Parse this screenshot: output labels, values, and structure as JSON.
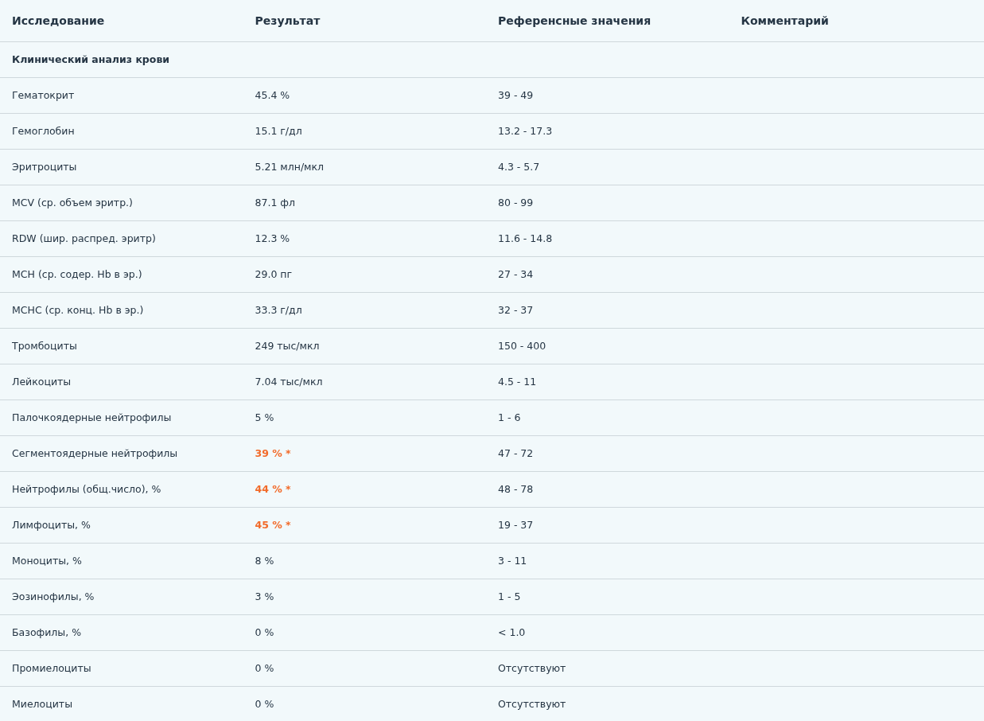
{
  "table": {
    "columns": [
      "Исследование",
      "Результат",
      "Референсные значения",
      "Комментарий"
    ],
    "section": "Клинический анализ крови",
    "rows": [
      {
        "name": "Гематокрит",
        "result": "45.4 %",
        "abnormal": false,
        "reference": "39 - 49"
      },
      {
        "name": "Гемоглобин",
        "result": "15.1 г/дл",
        "abnormal": false,
        "reference": "13.2 - 17.3"
      },
      {
        "name": "Эритроциты",
        "result": "5.21 млн/мкл",
        "abnormal": false,
        "reference": "4.3 - 5.7"
      },
      {
        "name": "MCV (ср. объем эритр.)",
        "result": "87.1 фл",
        "abnormal": false,
        "reference": "80 - 99"
      },
      {
        "name": "RDW (шир. распред. эритр)",
        "result": "12.3 %",
        "abnormal": false,
        "reference": "11.6 - 14.8"
      },
      {
        "name": "MCH (ср. содер. Hb в эр.)",
        "result": "29.0 пг",
        "abnormal": false,
        "reference": "27 - 34"
      },
      {
        "name": "MCHC (ср. конц. Hb в эр.)",
        "result": "33.3 г/дл",
        "abnormal": false,
        "reference": "32 - 37"
      },
      {
        "name": "Тромбоциты",
        "result": "249 тыс/мкл",
        "abnormal": false,
        "reference": "150 - 400"
      },
      {
        "name": "Лейкоциты",
        "result": "7.04 тыс/мкл",
        "abnormal": false,
        "reference": "4.5 - 11"
      },
      {
        "name": "Палочкоядерные нейтрофилы",
        "result": "5 %",
        "abnormal": false,
        "reference": "1 - 6"
      },
      {
        "name": "Сегментоядерные нейтрофилы",
        "result": "39 % *",
        "abnormal": true,
        "reference": "47 - 72"
      },
      {
        "name": "Нейтрофилы (общ.число), %",
        "result": "44 % *",
        "abnormal": true,
        "reference": "48 - 78"
      },
      {
        "name": "Лимфоциты, %",
        "result": "45 % *",
        "abnormal": true,
        "reference": "19 - 37"
      },
      {
        "name": "Моноциты, %",
        "result": "8 %",
        "abnormal": false,
        "reference": "3 - 11"
      },
      {
        "name": "Эозинофилы, %",
        "result": "3 %",
        "abnormal": false,
        "reference": "1 - 5"
      },
      {
        "name": "Базофилы, %",
        "result": "0 %",
        "abnormal": false,
        "reference": "< 1.0"
      },
      {
        "name": "Промиелоциты",
        "result": "0 %",
        "abnormal": false,
        "reference": "Отсутствуют"
      },
      {
        "name": "Миелоциты",
        "result": "0 %",
        "abnormal": false,
        "reference": "Отсутствуют"
      }
    ]
  }
}
